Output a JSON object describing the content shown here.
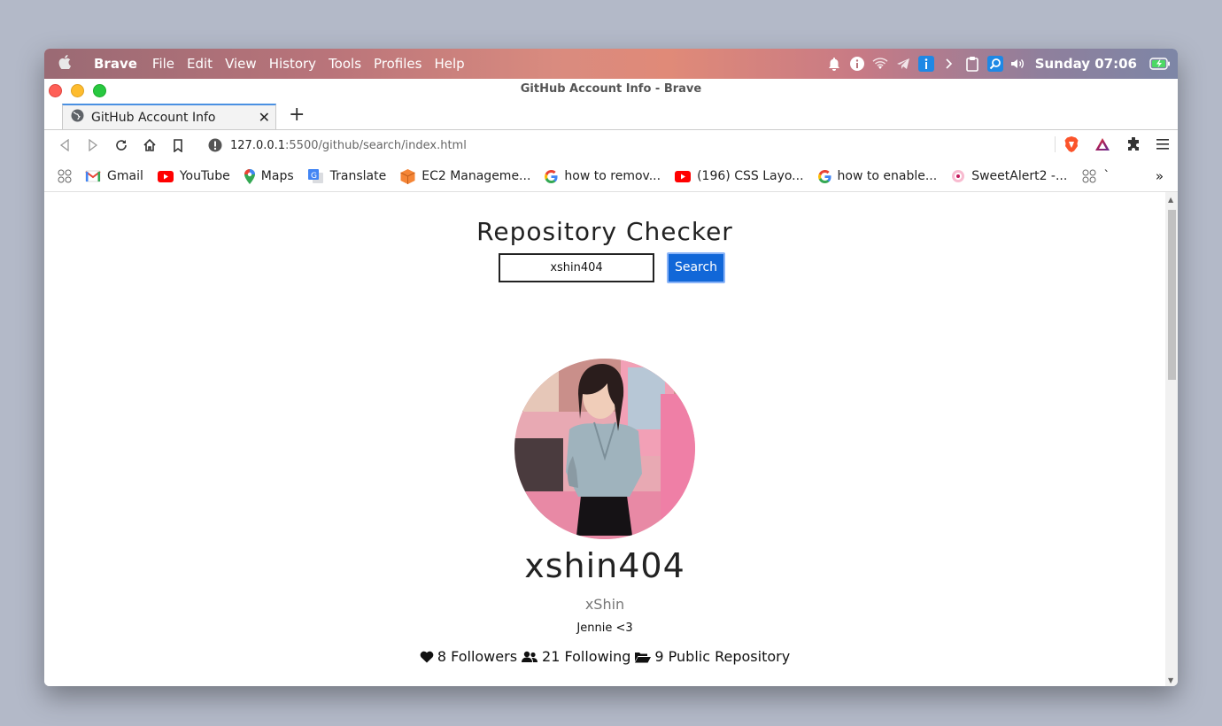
{
  "menubar": {
    "app_name": "Brave",
    "items": [
      "File",
      "Edit",
      "View",
      "History",
      "Tools",
      "Profiles",
      "Help"
    ],
    "clock": "Sunday 07:06"
  },
  "window": {
    "title": "GitHub Account Info - Brave"
  },
  "tab": {
    "label": "GitHub Account Info"
  },
  "address": {
    "host": "127.0.0.1",
    "rest": ":5500/github/search/index.html"
  },
  "bookmarks": [
    {
      "label": "Gmail",
      "icon": "gmail-icon"
    },
    {
      "label": "YouTube",
      "icon": "youtube-icon"
    },
    {
      "label": "Maps",
      "icon": "maps-icon"
    },
    {
      "label": "Translate",
      "icon": "translate-icon"
    },
    {
      "label": "EC2 Manageme...",
      "icon": "aws-icon"
    },
    {
      "label": "how to remov...",
      "icon": "google-icon"
    },
    {
      "label": "(196) CSS Layo...",
      "icon": "youtube-icon"
    },
    {
      "label": "how to enable...",
      "icon": "google-icon"
    },
    {
      "label": "SweetAlert2 -...",
      "icon": "sweetalert-icon"
    },
    {
      "label": "`",
      "icon": "apps-icon"
    }
  ],
  "page": {
    "heading": "Repository Checker",
    "search_value": "xshin404",
    "search_button": "Search",
    "username": "xshin404",
    "real_name": "xShin",
    "bio": "Jennie <3",
    "followers": "8 Followers",
    "following": "21 Following",
    "repos": "9 Public Repository"
  },
  "colors": {
    "accent": "#1167d8",
    "brave": "#fb542b"
  }
}
